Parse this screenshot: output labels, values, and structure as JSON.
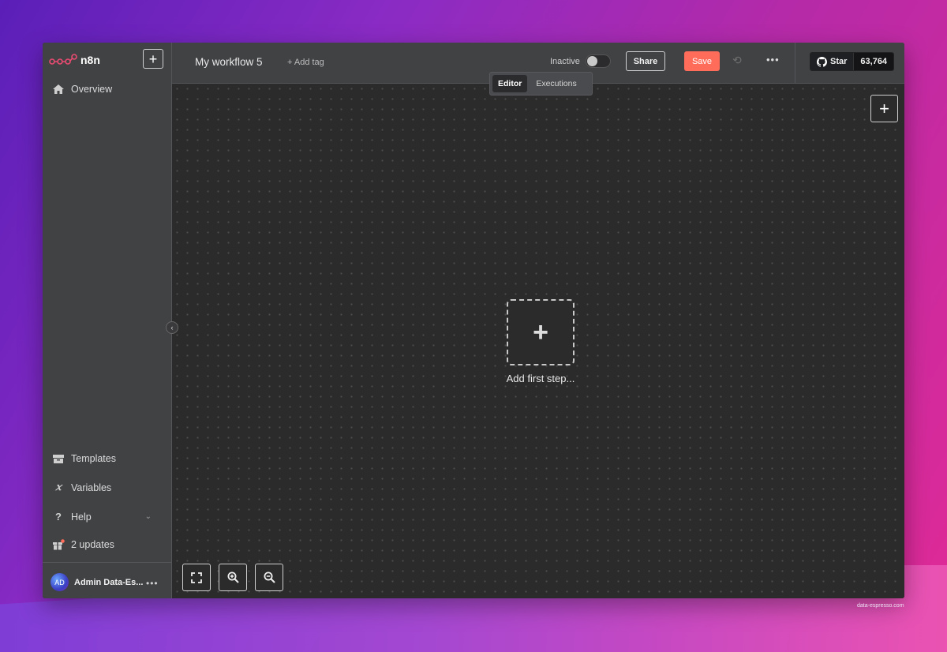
{
  "app": {
    "logo_text": "n8n"
  },
  "sidebar": {
    "add_label": "+",
    "top_items": [
      {
        "label": "Overview",
        "icon": "home-icon"
      }
    ],
    "bottom_items": [
      {
        "label": "Templates",
        "icon": "box-icon"
      },
      {
        "label": "Variables",
        "icon": "variable-icon"
      },
      {
        "label": "Help",
        "icon": "question-icon"
      },
      {
        "label": "2 updates",
        "icon": "gift-icon"
      }
    ],
    "user": {
      "initials": "AD",
      "name": "Admin Data-Es..."
    }
  },
  "header": {
    "workflow_name": "My workflow 5",
    "add_tag": "+ Add tag",
    "status_label": "Inactive",
    "share_label": "Share",
    "save_label": "Save",
    "github": {
      "star_label": "Star",
      "count": "63,764"
    }
  },
  "tabs": [
    {
      "label": "Editor",
      "active": true
    },
    {
      "label": "Executions",
      "active": false
    }
  ],
  "canvas": {
    "add_node_label": "+",
    "first_step_label": "Add first step..."
  },
  "watermark": "data-espresso.com",
  "colors": {
    "accent": "#ff6d5a",
    "canvas": "#2b2b2b",
    "sidebar": "#414244"
  }
}
